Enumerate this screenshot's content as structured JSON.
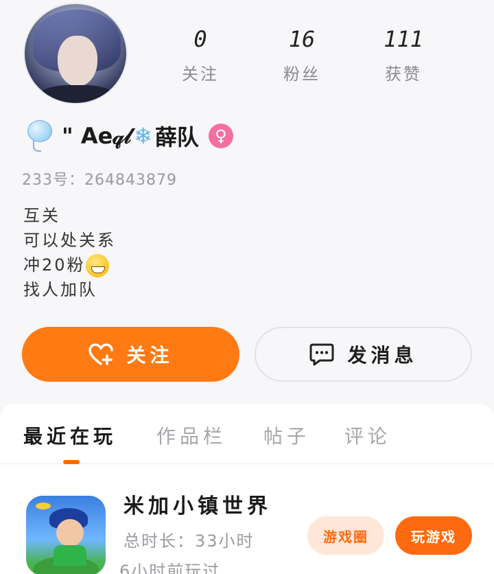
{
  "profile": {
    "username": "\" Ae𝓆𝓁",
    "username_suffix": "薛队",
    "snowflake_glyph": "❄",
    "gender_glyph": "♀",
    "gender_color": "#f36fa0",
    "uid_label": "233号：",
    "uid": "264843879",
    "bio_lines": [
      "互关",
      "可以处关系",
      "冲20粉",
      "找人加队"
    ]
  },
  "stats": [
    {
      "value": "0",
      "label": "关注"
    },
    {
      "value": "16",
      "label": "粉丝"
    },
    {
      "value": "111",
      "label": "获赞"
    }
  ],
  "actions": {
    "follow_label": "关注",
    "message_label": "发消息",
    "accent": "#ff7a12"
  },
  "tabs": [
    {
      "label": "最近在玩",
      "active": true
    },
    {
      "label": "作品栏",
      "active": false
    },
    {
      "label": "帖子",
      "active": false
    },
    {
      "label": "评论",
      "active": false
    }
  ],
  "recent_game": {
    "title": "米加小镇世界",
    "total_time": "总时长：33小时",
    "last_played": "6小时前玩过",
    "circle_label": "游戏圈",
    "play_label": "玩游戏"
  }
}
